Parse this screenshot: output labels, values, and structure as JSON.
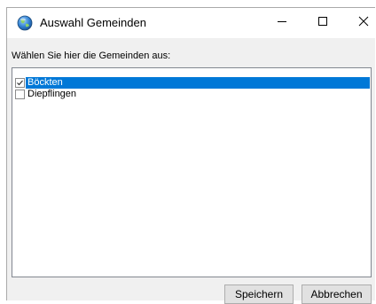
{
  "window": {
    "title": "Auswahl Gemeinden",
    "icon": "globe-icon",
    "controls": {
      "minimize": "minimize-icon",
      "maximize": "maximize-icon",
      "close": "close-icon"
    }
  },
  "prompt": "Wählen Sie hier die Gemeinden aus:",
  "list": {
    "items": [
      {
        "label": "Böckten",
        "checked": true,
        "selected": true
      },
      {
        "label": "Diepflingen",
        "checked": false,
        "selected": false
      }
    ]
  },
  "buttons": {
    "save": "Speichern",
    "cancel": "Abbrechen"
  },
  "colors": {
    "selection": "#0078d7",
    "dialog_background": "#f0f0f0"
  }
}
